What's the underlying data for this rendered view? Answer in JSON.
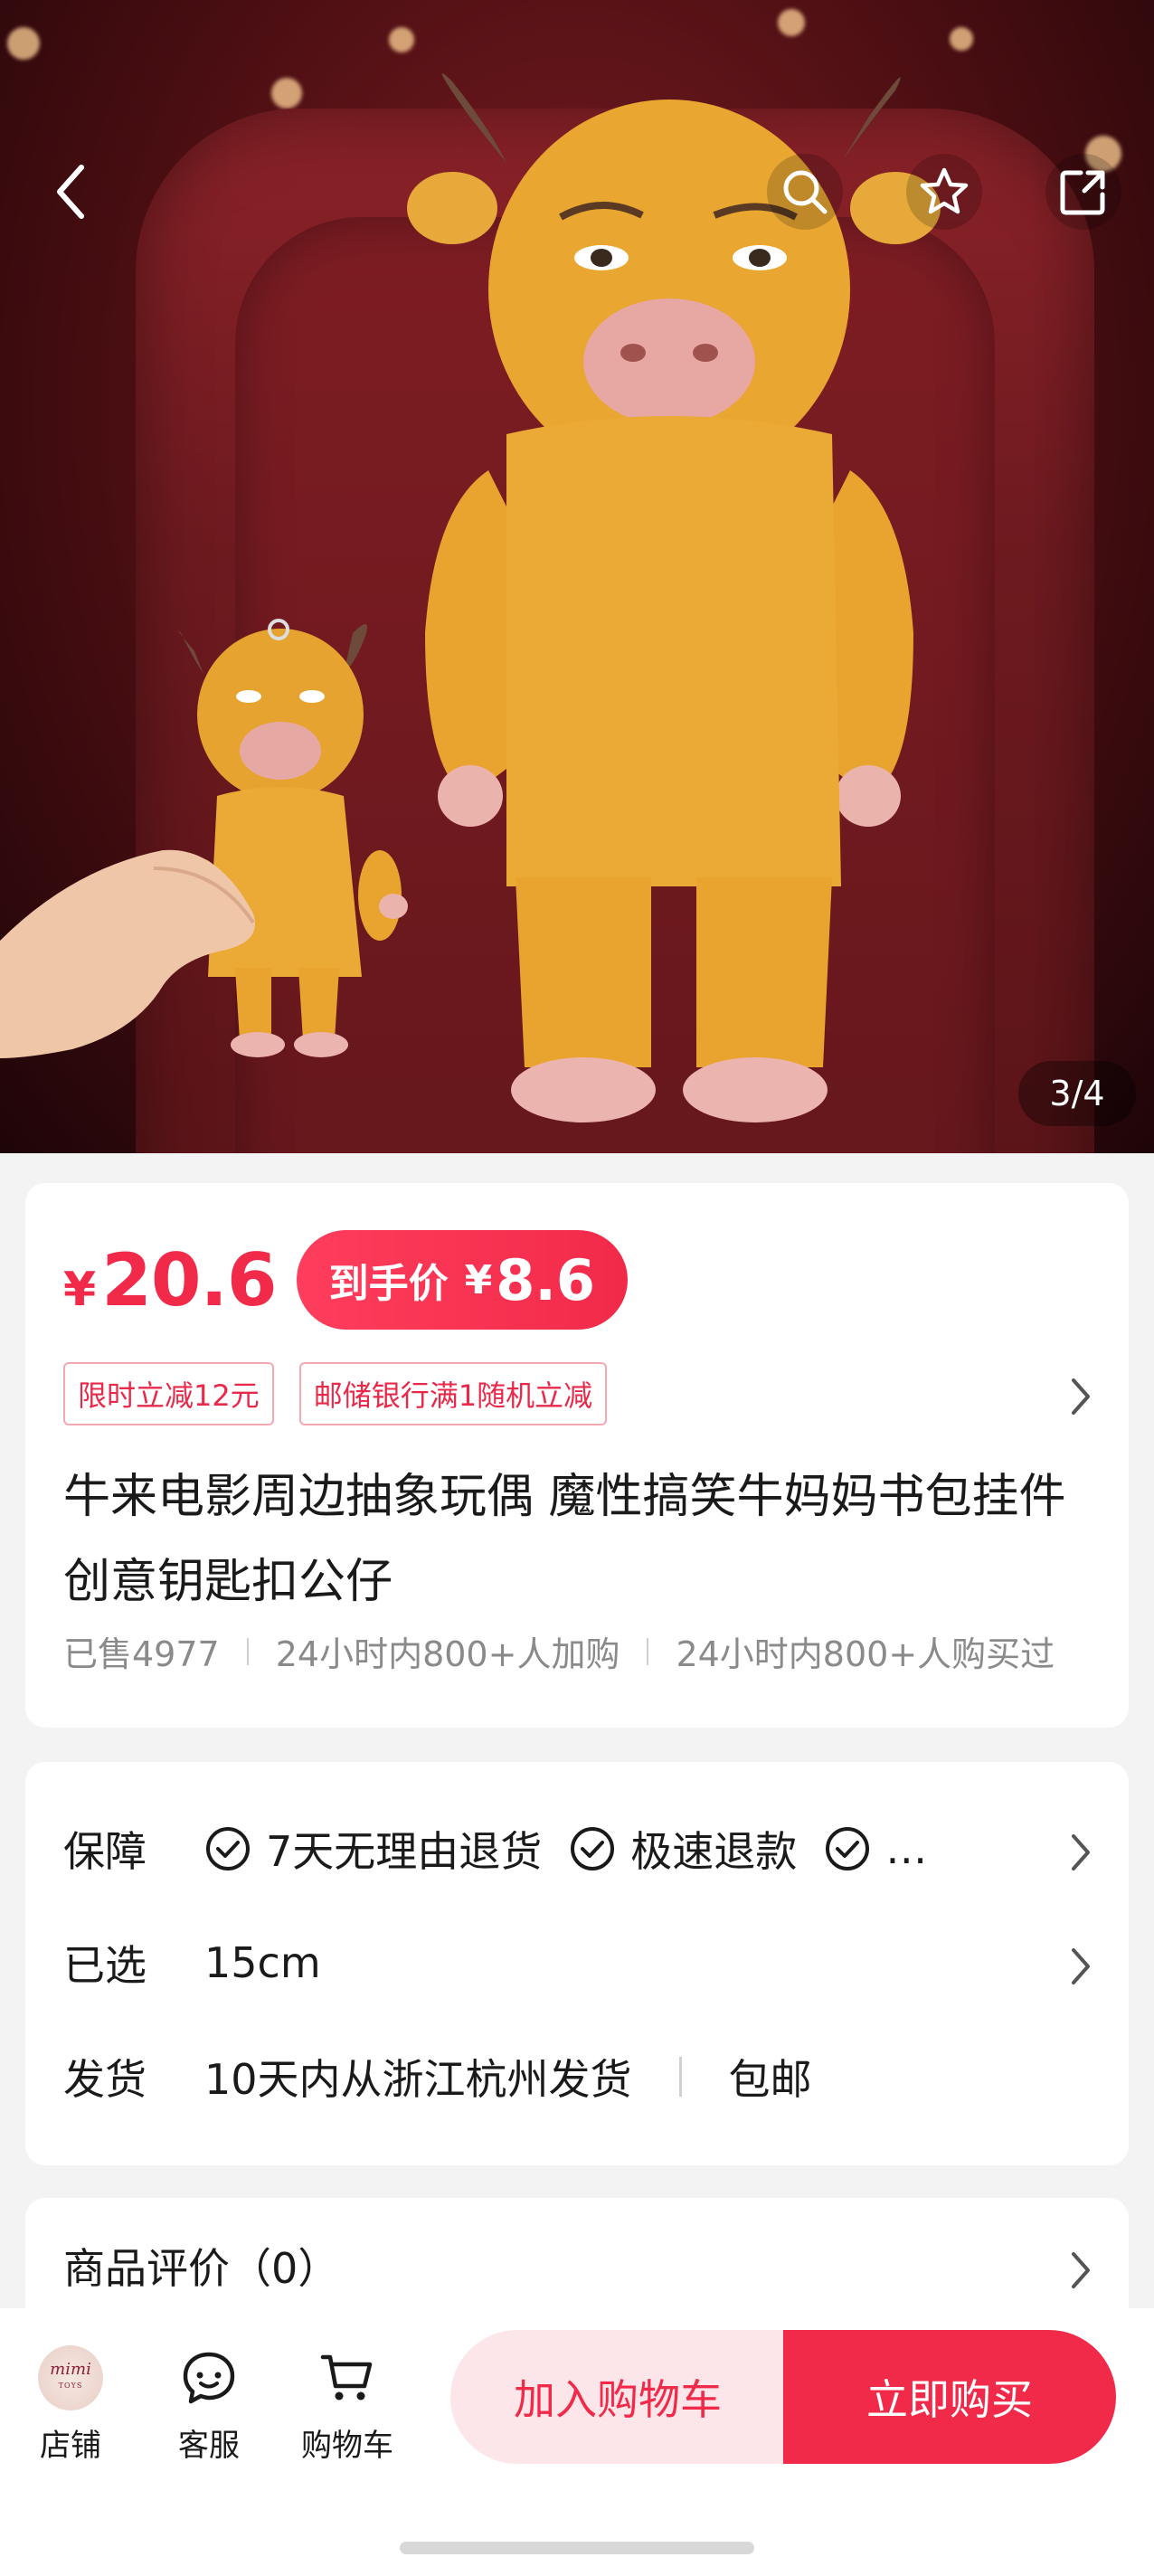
{
  "hero": {
    "counter": "3/4",
    "image_alt": "cow plush toys on a red cinema seat"
  },
  "topbar": {
    "back_icon": "chevron-left-icon",
    "search_icon": "search-icon",
    "favorite_icon": "star-icon",
    "share_icon": "share-icon"
  },
  "price": {
    "currency": "¥",
    "amount": "20.6",
    "final_label": "到手价",
    "final_currency": "¥",
    "final_amount": "8.6"
  },
  "promos": [
    "限时立减12元",
    "邮储银行满1随机立减"
  ],
  "product": {
    "title": "牛来电影周边抽象玩偶 魔性搞笑牛妈妈书包挂件创意钥匙扣公仔"
  },
  "stats": [
    "已售4977",
    "24小时内800+人加购",
    "24小时内800+人购买过"
  ],
  "info": {
    "guarantee": {
      "label": "保障",
      "items": [
        "7天无理由退货",
        "极速退款",
        "…"
      ]
    },
    "selected": {
      "label": "已选",
      "value": "15cm"
    },
    "shipping": {
      "label": "发货",
      "value": "10天内从浙江杭州发货",
      "extra": "包邮"
    }
  },
  "reviews": {
    "title": "商品评价（0）"
  },
  "bottom_bar": {
    "store_label": "店铺",
    "store_logo_text": "mimi",
    "store_logo_sub": "TOYS",
    "service_label": "客服",
    "cart_label": "购物车",
    "add_to_cart": "加入购物车",
    "buy_now": "立即购买"
  },
  "colors": {
    "accent": "#f22a4a",
    "accent_light": "#fde6ea",
    "promo_border": "#f6a7b4"
  }
}
